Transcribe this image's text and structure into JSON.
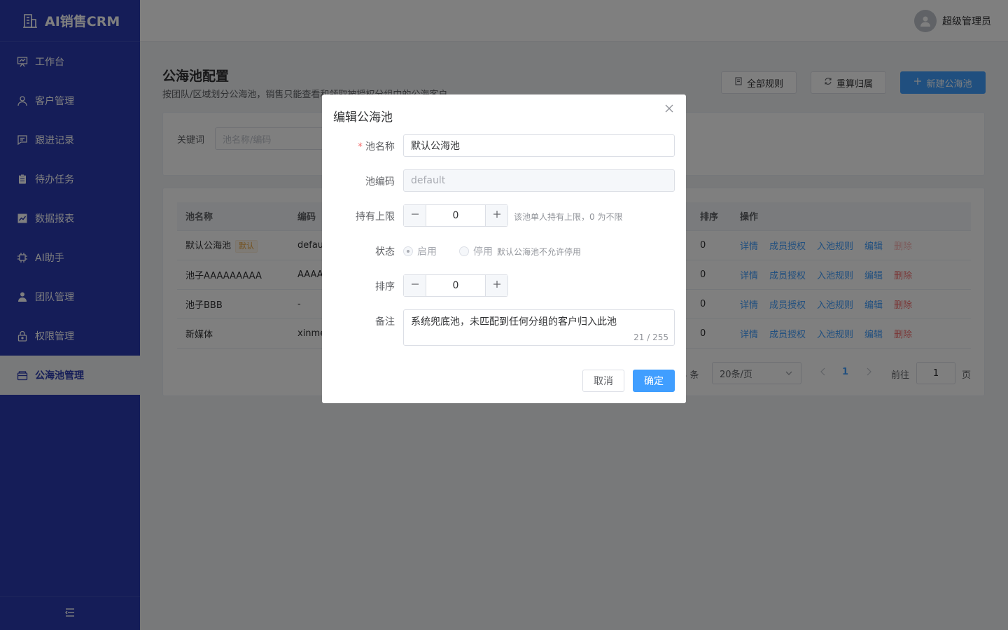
{
  "brand": {
    "name": "AI销售CRM"
  },
  "header": {
    "user_name": "超级管理员"
  },
  "sidebar": {
    "items": [
      {
        "label": "工作台",
        "icon": "presentation-icon"
      },
      {
        "label": "客户管理",
        "icon": "user-icon"
      },
      {
        "label": "跟进记录",
        "icon": "chat-icon"
      },
      {
        "label": "待办任务",
        "icon": "clipboard-icon"
      },
      {
        "label": "数据报表",
        "icon": "chart-icon"
      },
      {
        "label": "AI助手",
        "icon": "chip-icon"
      },
      {
        "label": "团队管理",
        "icon": "team-icon"
      },
      {
        "label": "权限管理",
        "icon": "lock-icon"
      },
      {
        "label": "公海池管理",
        "icon": "box-icon"
      }
    ],
    "active_index": 8
  },
  "page": {
    "title": "公海池配置",
    "subtitle": "按团队/区域划分公海池，销售只能查看和领取被授权分组中的公海客户",
    "buttons": {
      "all_rules": "全部规则",
      "recalc": "重算归属",
      "create": "新建公海池"
    }
  },
  "filter": {
    "label": "关键词",
    "placeholder": "池名称/编码"
  },
  "table": {
    "headers": {
      "name": "池名称",
      "code": "编码",
      "sort": "排序",
      "ops": "操作"
    },
    "rows": [
      {
        "name": "默认公海池",
        "tag": "默认",
        "code": "defau",
        "sort": "0"
      },
      {
        "name": "池子AAAAAAAAA",
        "tag": "",
        "code": "AAAA",
        "sort": "0"
      },
      {
        "name": "池子BBB",
        "tag": "",
        "code": "-",
        "sort": "0"
      },
      {
        "name": "新媒体",
        "tag": "",
        "code": "xinme",
        "sort": "0"
      }
    ],
    "ops": {
      "detail": "详情",
      "members": "成员授权",
      "rules": "入池规则",
      "edit": "编辑",
      "delete": "删除"
    }
  },
  "pager": {
    "total_suffix": "4 条",
    "page_size": "20条/页",
    "current": "1",
    "goto_label": "前往",
    "goto_value": "1",
    "page_suffix": "页"
  },
  "dialog": {
    "title": "编辑公海池",
    "fields": {
      "name_label": "池名称",
      "name_value": "默认公海池",
      "code_label": "池编码",
      "code_value": "default",
      "limit_label": "持有上限",
      "limit_value": "0",
      "limit_hint": "该池单人持有上限，0 为不限",
      "status_label": "状态",
      "status_on": "启用",
      "status_off": "停用",
      "status_note": "默认公海池不允许停用",
      "sort_label": "排序",
      "sort_value": "0",
      "remark_label": "备注",
      "remark_value": "系统兜底池，未匹配到任何分组的客户归入此池",
      "remark_count": "21 / 255"
    },
    "cancel": "取消",
    "confirm": "确定"
  }
}
